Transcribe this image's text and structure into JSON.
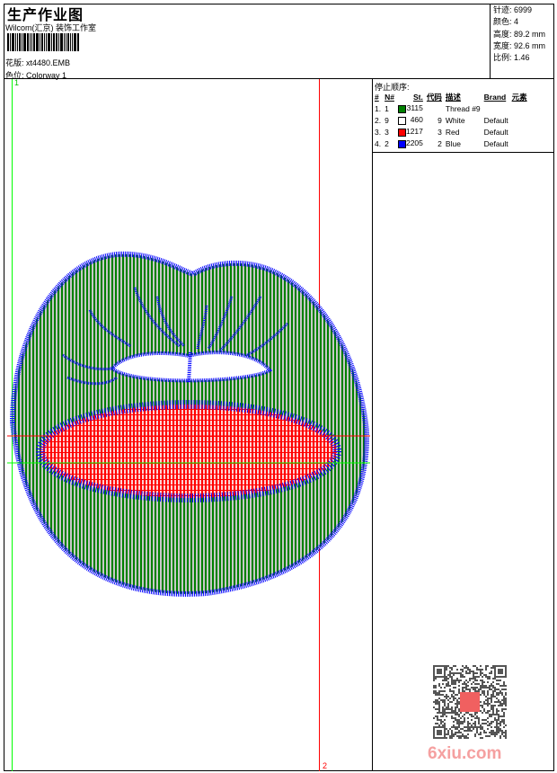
{
  "header": {
    "title": "生产作业图",
    "company": "Wilcom(汇京) 装饰工作室",
    "pattern_label": "花版:",
    "pattern_value": "xt4480.EMB",
    "colorway_label": "色位:",
    "colorway_value": "Colorway 1"
  },
  "info": {
    "stitches": "针迹: 6999",
    "colors": "颜色: 4",
    "height": "高度: 89.2 mm",
    "width": "宽度: 92.6 mm",
    "scale": "比例: 1.46"
  },
  "stop_sequence": {
    "title": "停止顺序:",
    "headers": [
      "#",
      "N#",
      "St.",
      "代码",
      "描述",
      "Brand",
      "元素"
    ],
    "rows": [
      {
        "n": "1.",
        "num": "1",
        "color": "#008000",
        "st": "3115",
        "code": "",
        "desc": "Thread #9",
        "brand": ""
      },
      {
        "n": "2.",
        "num": "9",
        "color": "#ffffff",
        "st": "460",
        "code": "9",
        "desc": "White",
        "brand": "Default"
      },
      {
        "n": "3.",
        "num": "3",
        "color": "#ff0000",
        "st": "1217",
        "code": "3",
        "desc": "Red",
        "brand": "Default"
      },
      {
        "n": "4.",
        "num": "2",
        "color": "#0000ff",
        "st": "2205",
        "code": "2",
        "desc": "Blue",
        "brand": "Default"
      }
    ]
  },
  "markers": {
    "start": "1",
    "end": "2"
  },
  "colors": {
    "green": "#008000",
    "blue": "#0000ff",
    "red": "#ff0000",
    "guide_green": "#00ff00"
  },
  "watermark": {
    "site": "6xiu.com"
  }
}
